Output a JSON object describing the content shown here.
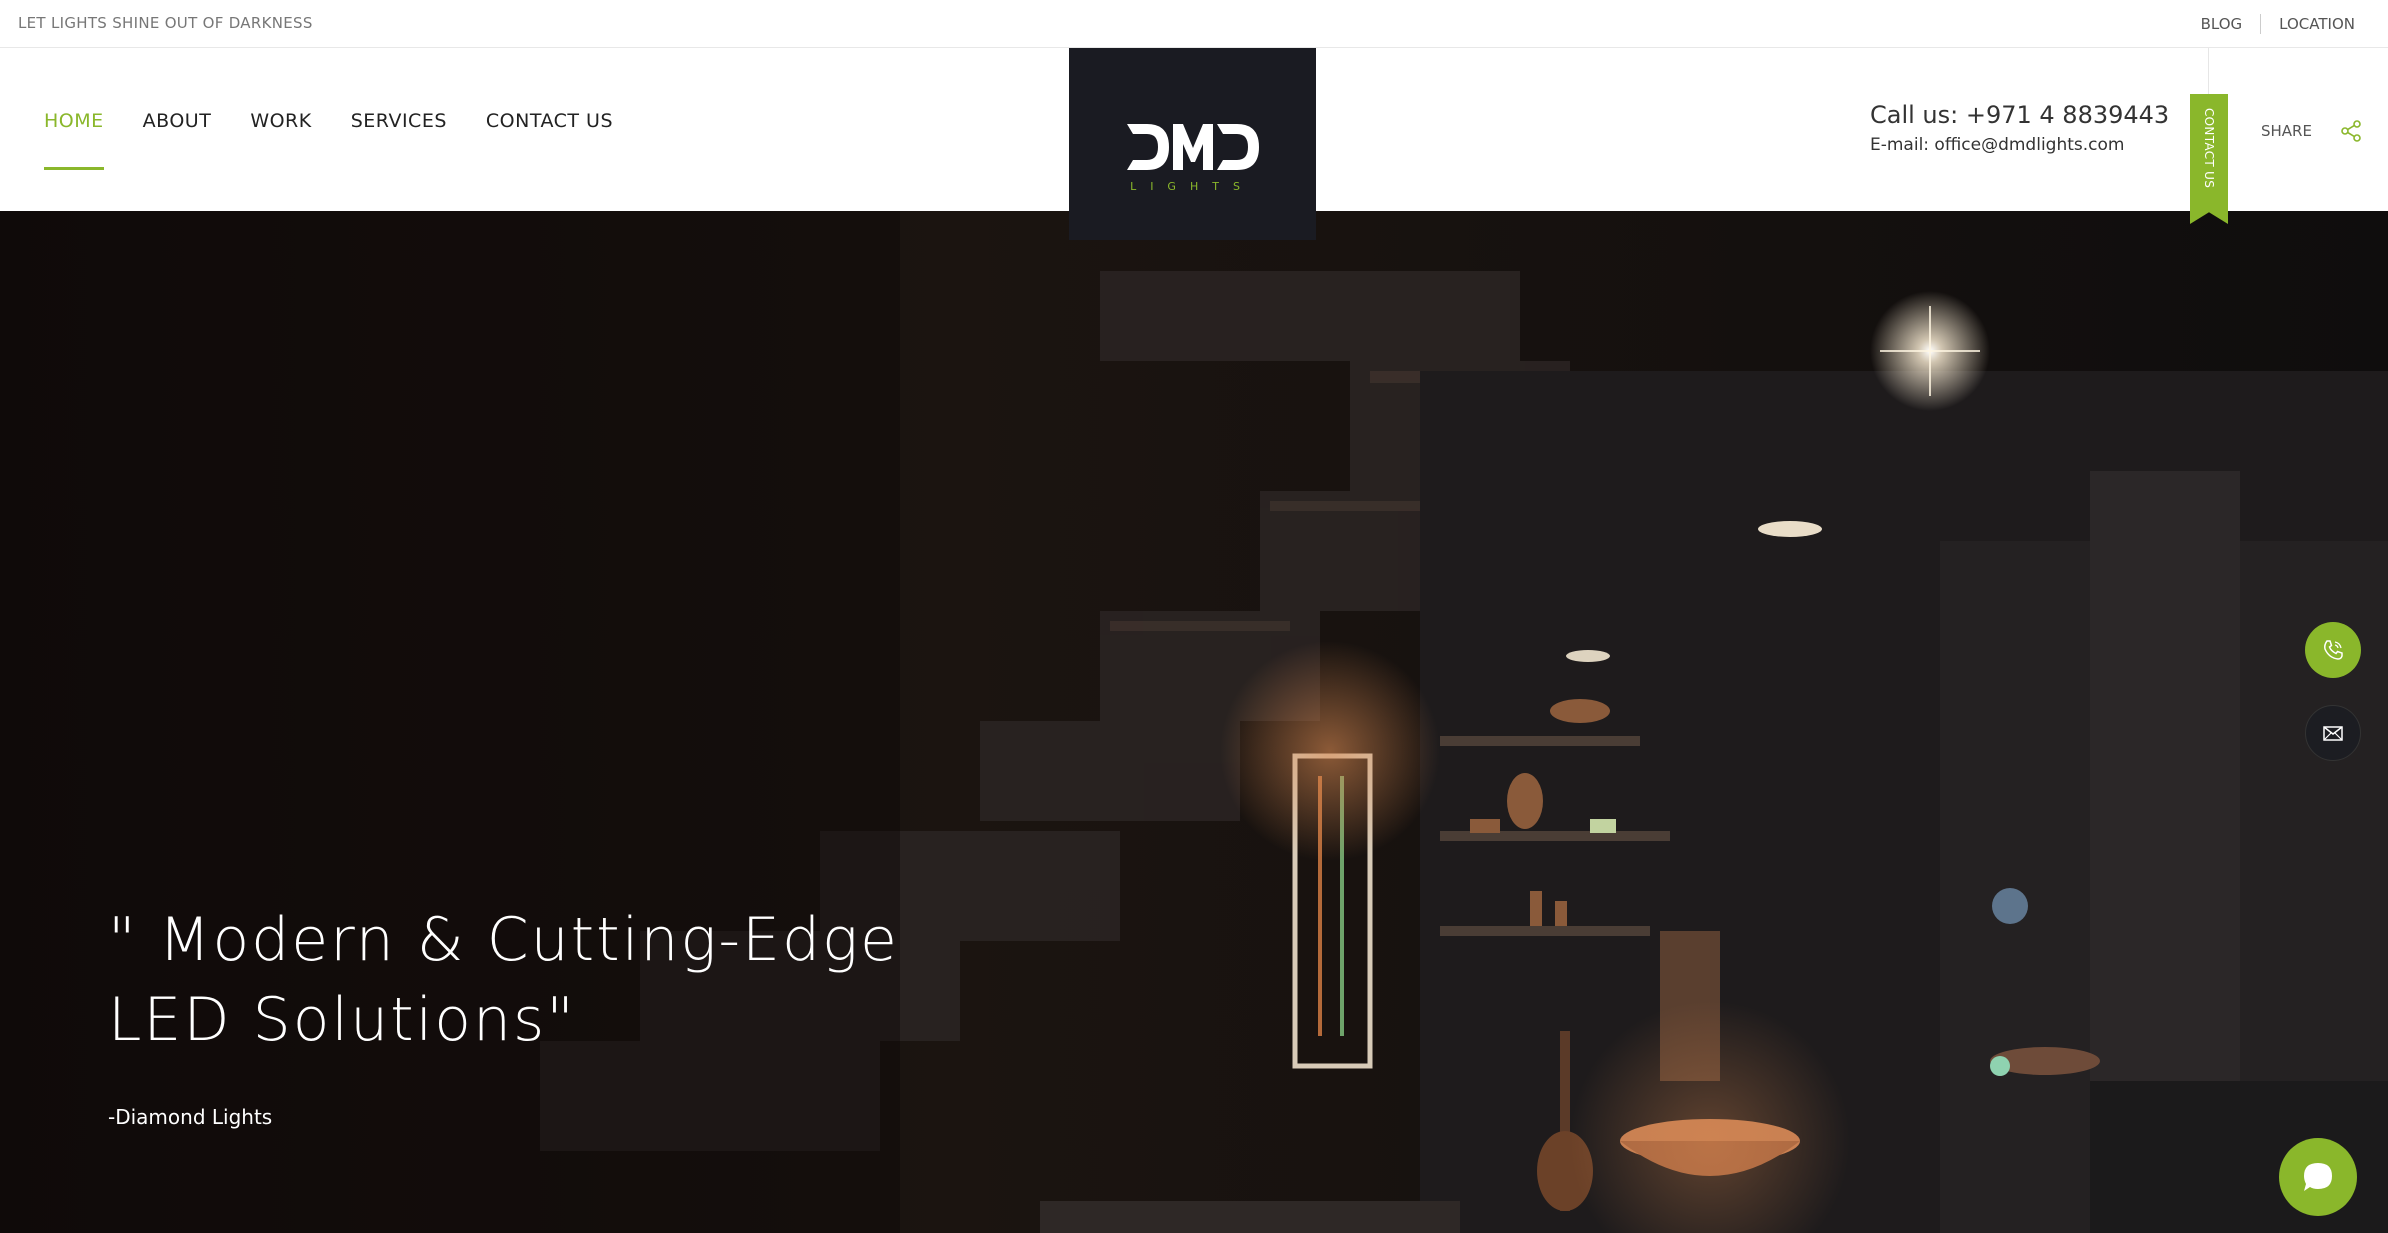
{
  "topbar": {
    "tagline": "LET LIGHTS SHINE OUT OF DARKNESS",
    "blog": "BLOG",
    "location": "LOCATION"
  },
  "nav": {
    "items": [
      {
        "label": "HOME",
        "active": true
      },
      {
        "label": "ABOUT"
      },
      {
        "label": "WORK"
      },
      {
        "label": "SERVICES"
      },
      {
        "label": "CONTACT US"
      }
    ]
  },
  "logo": {
    "main": "DMD",
    "sub": "LIGHTS"
  },
  "contact": {
    "call": "Call us: +971 4 8839443",
    "email": "E-mail: office@dmdlights.com",
    "ribbon": "CONTACT US"
  },
  "share": {
    "label": "SHARE",
    "icon": "share-icon"
  },
  "hero": {
    "quote_line1": "\" Modern & Cutting-Edge",
    "quote_line2": "LED Solutions\"",
    "author": "-Diamond Lights"
  },
  "floating": {
    "phone_icon": "phone-icon",
    "mail_icon": "mail-icon",
    "chat_icon": "chat-icon"
  },
  "colors": {
    "accent": "#8ab72b",
    "logo_bg": "#1a1b22",
    "text_dark": "#222222"
  }
}
